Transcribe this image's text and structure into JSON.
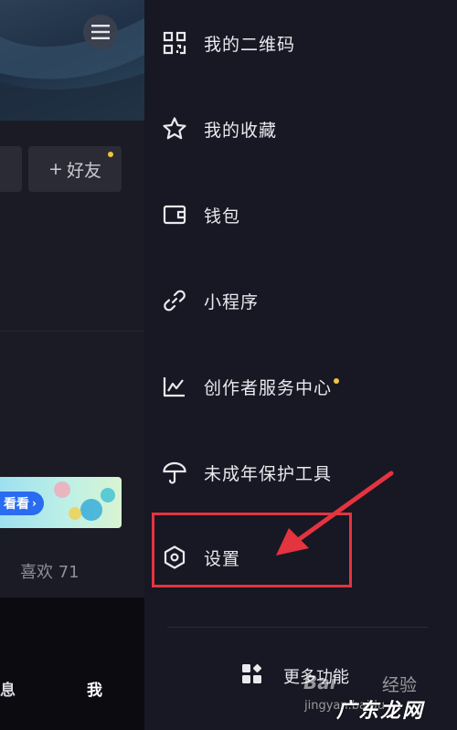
{
  "profile_page": {
    "add_friend_label": "好友",
    "add_friend_symbol": "+",
    "promo_label": "看看",
    "likes_label": "喜欢 71",
    "nav": {
      "messages": "息",
      "me": "我"
    }
  },
  "drawer": {
    "items": [
      {
        "label": "我的二维码",
        "icon": "qr-code-icon"
      },
      {
        "label": "我的收藏",
        "icon": "star-icon"
      },
      {
        "label": "钱包",
        "icon": "wallet-icon"
      },
      {
        "label": "小程序",
        "icon": "link-icon"
      },
      {
        "label": "创作者服务中心",
        "icon": "chart-icon",
        "has_dot": true
      },
      {
        "label": "未成年保护工具",
        "icon": "umbrella-icon"
      },
      {
        "label": "设置",
        "icon": "hexagon-settings-icon"
      }
    ],
    "more_label": "更多功能"
  },
  "watermark": {
    "baidu": "Bai",
    "jingyan": "经验",
    "url": "jingyan.baidu",
    "site": "广东龙网"
  },
  "colors": {
    "drawer_bg": "#171823",
    "highlight": "#e3343f",
    "notification_dot": "#f3c33c"
  }
}
